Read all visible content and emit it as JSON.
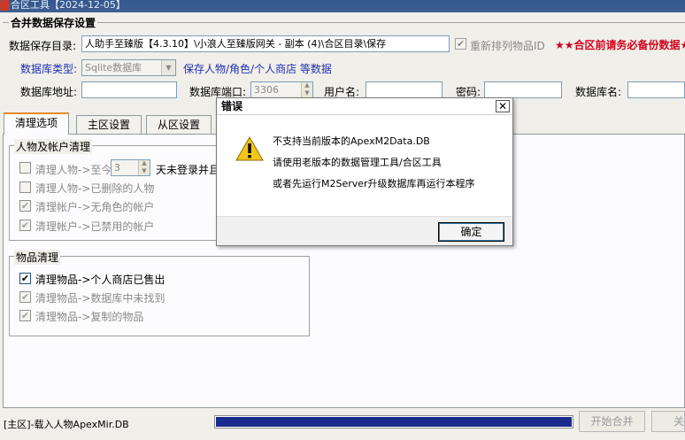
{
  "window": {
    "title": "合区工具【2024-12-05】"
  },
  "save_settings": {
    "section_title": "合并数据保存设置",
    "dir_label": "数据保存目录:",
    "dir_value": "人助手至臻版【4.3.10】\\小浪人至臻版网关 - 副本 (4)\\合区目录\\保存",
    "reorder_label": "重新排列物品ID",
    "reorder_checked": true,
    "warning": "★★合区前请务必备份数据★",
    "db_type_label": "数据库类型:",
    "db_type_value": "Sqlite数据库",
    "db_type_desc": "保存人物/角色/个人商店 等数据",
    "db_addr_label": "数据库地址:",
    "db_addr_value": "",
    "db_port_label": "数据库端口:",
    "db_port_value": "3306",
    "username_label": "用户名:",
    "username_value": "",
    "password_label": "密码:",
    "password_value": "",
    "db_name_label": "数据库名:",
    "db_name_value": ""
  },
  "tabs": [
    {
      "label": "清理选项",
      "active": true
    },
    {
      "label": "主区设置",
      "active": false
    },
    {
      "label": "从区设置",
      "active": false
    }
  ],
  "char_cleanup": {
    "title": "人物及帐户清理",
    "items": [
      {
        "label": "清理人物->至今",
        "checked": false,
        "enabled": false
      },
      {
        "label": "清理人物->已删除的人物",
        "checked": false,
        "enabled": false
      },
      {
        "label": "清理帐户->无角色的帐户",
        "checked": true,
        "enabled": false
      },
      {
        "label": "清理帐户->已禁用的帐户",
        "checked": true,
        "enabled": false
      }
    ],
    "days_value": "3",
    "days_suffix": "天未登录并且"
  },
  "item_cleanup": {
    "title": "物品清理",
    "items": [
      {
        "label": "清理物品->个人商店已售出",
        "checked": true,
        "enabled": true
      },
      {
        "label": "清理物品->数据库中未找到",
        "checked": true,
        "enabled": false
      },
      {
        "label": "清理物品->复制的物品",
        "checked": true,
        "enabled": false
      }
    ]
  },
  "dialog": {
    "title": "错误",
    "close_glyph": "✕",
    "icon": "warning-icon",
    "lines": [
      "不支持当前版本的ApexM2Data.DB",
      "请使用老版本的数据管理工具/合区工具",
      "或者先运行M2Server升级数据库再运行本程序"
    ],
    "ok_label": "确定"
  },
  "status": {
    "text": "[主区]-载入人物ApexMir.DB",
    "progress": 1.0
  },
  "buttons": {
    "start_merge": "开始合并",
    "close": "关"
  },
  "colors": {
    "accent_blue": "#1f2fb5",
    "warning_red": "#d3001b",
    "progress_fill": "#1b2a8c"
  }
}
